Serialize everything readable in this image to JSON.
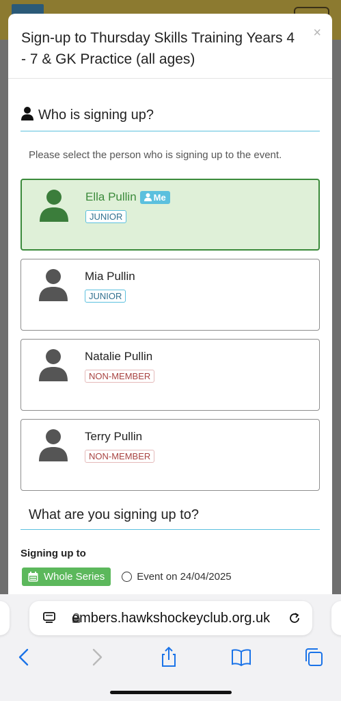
{
  "modal": {
    "title": "Sign-up to Thursday Skills Training Years 4 - 7 & GK Practice (all ages)",
    "close": "×"
  },
  "who": {
    "heading": "Who is signing up?",
    "help": "Please select the person who is signing up to the event.",
    "people": [
      {
        "name": "Ella Pullin",
        "badge": "Me",
        "tag": "JUNIOR",
        "selected": true
      },
      {
        "name": "Mia Pullin",
        "tag": "JUNIOR"
      },
      {
        "name": "Natalie Pullin",
        "tag": "NON-MEMBER"
      },
      {
        "name": "Terry Pullin",
        "tag": "NON-MEMBER"
      }
    ]
  },
  "what": {
    "heading": "What are you signing up to?",
    "label": "Signing up to",
    "series_btn": "Whole Series",
    "event_option": "Event on 24/04/2025"
  },
  "browser": {
    "url": "embers.hawkshockeyclub.org.uk"
  },
  "colors": {
    "selected_green": "#3b8a3b",
    "selected_bg": "#dff0d8",
    "info_blue": "#5bc0de",
    "danger_red": "#a94442",
    "success_green": "#5cb85c"
  }
}
